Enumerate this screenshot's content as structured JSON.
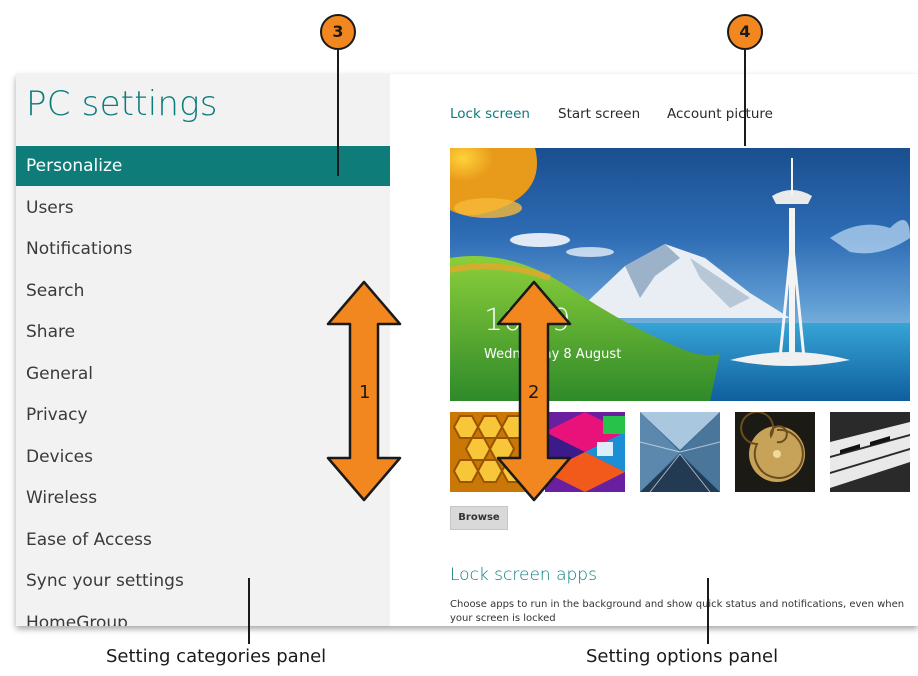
{
  "window": {
    "title": "PC settings"
  },
  "categories": [
    {
      "label": "Personalize",
      "selected": true
    },
    {
      "label": "Users",
      "selected": false
    },
    {
      "label": "Notifications",
      "selected": false
    },
    {
      "label": "Search",
      "selected": false
    },
    {
      "label": "Share",
      "selected": false
    },
    {
      "label": "General",
      "selected": false
    },
    {
      "label": "Privacy",
      "selected": false
    },
    {
      "label": "Devices",
      "selected": false
    },
    {
      "label": "Wireless",
      "selected": false
    },
    {
      "label": "Ease of Access",
      "selected": false
    },
    {
      "label": "Sync your settings",
      "selected": false
    },
    {
      "label": "HomeGroup",
      "selected": false
    }
  ],
  "tabs": [
    {
      "label": "Lock screen",
      "active": true
    },
    {
      "label": "Start screen",
      "active": false
    },
    {
      "label": "Account picture",
      "active": false
    }
  ],
  "lock_preview": {
    "time": "10:09",
    "date": "Wednesday 8 August"
  },
  "thumbnails": [
    {
      "name": "honeycomb-thumbnail"
    },
    {
      "name": "color-blocks-thumbnail"
    },
    {
      "name": "tunnel-thumbnail"
    },
    {
      "name": "nautilus-thumbnail"
    },
    {
      "name": "piano-keys-thumbnail"
    }
  ],
  "browse_label": "Browse",
  "lock_screen_apps": {
    "heading": "Lock screen apps",
    "description": "Choose apps to run in the background and show quick status and notifications, even when your screen is locked"
  },
  "callouts": {
    "c3": "3",
    "c4": "4",
    "arrow1": "1",
    "arrow2": "2"
  },
  "captions": {
    "left": "Setting categories panel",
    "right": "Setting options panel"
  },
  "colors": {
    "accent": "#0e7d7a",
    "callout": "#f2871f",
    "left_panel_bg": "#f2f2f2"
  }
}
